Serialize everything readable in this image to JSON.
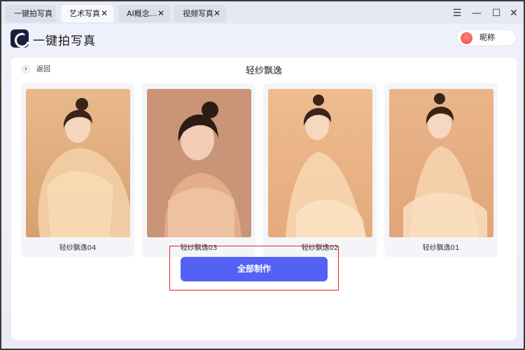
{
  "tabs": [
    {
      "label": "一键拍写真",
      "active": false,
      "closable": false
    },
    {
      "label": "艺术写真",
      "active": true,
      "closable": true
    },
    {
      "label": "AI概念...",
      "active": false,
      "closable": true
    },
    {
      "label": "视频写真",
      "active": false,
      "closable": true
    }
  ],
  "window_controls": {
    "menu": "☰",
    "minimize": "—",
    "maximize": "☐",
    "close": "✕"
  },
  "header": {
    "app_title": "一键拍写真",
    "user_nickname": "昵称"
  },
  "panel": {
    "back_label": "返回",
    "title": "轻纱飘逸",
    "cards": [
      {
        "label": "轻纱飘逸04"
      },
      {
        "label": "轻纱飘逸03"
      },
      {
        "label": "轻纱飘逸02"
      },
      {
        "label": "轻纱飘逸01"
      }
    ],
    "make_all_label": "全部制作"
  },
  "colors": {
    "accent": "#5461f5",
    "highlight_border": "#e02525"
  }
}
